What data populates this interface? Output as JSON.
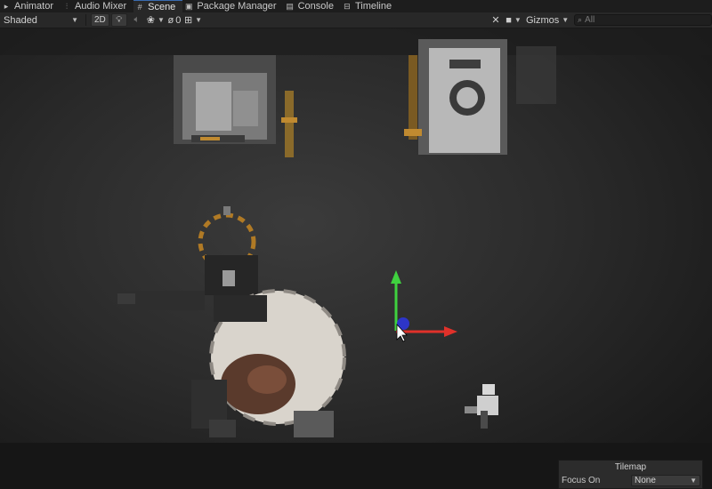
{
  "tabs": [
    {
      "label": "Animator",
      "icon": "animator-icon",
      "active": false
    },
    {
      "label": "Audio Mixer",
      "icon": "audio-mixer-icon",
      "active": false
    },
    {
      "label": "Scene",
      "icon": "scene-grid-icon",
      "active": true
    },
    {
      "label": "Package Manager",
      "icon": "package-icon",
      "active": false
    },
    {
      "label": "Console",
      "icon": "console-icon",
      "active": false
    },
    {
      "label": "Timeline",
      "icon": "timeline-icon",
      "active": false
    }
  ],
  "toolbar": {
    "draw_mode": "Shaded",
    "mode_2d": "2D",
    "fx_count": "0",
    "gizmos_label": "Gizmos",
    "search_placeholder": "All"
  },
  "tilemap_overlay": {
    "title": "Tilemap",
    "focus_label": "Focus On",
    "focus_value": "None"
  },
  "colors": {
    "gizmo_y": "#3fd13f",
    "gizmo_x": "#e0312a",
    "gizmo_z": "#2d35c8"
  }
}
